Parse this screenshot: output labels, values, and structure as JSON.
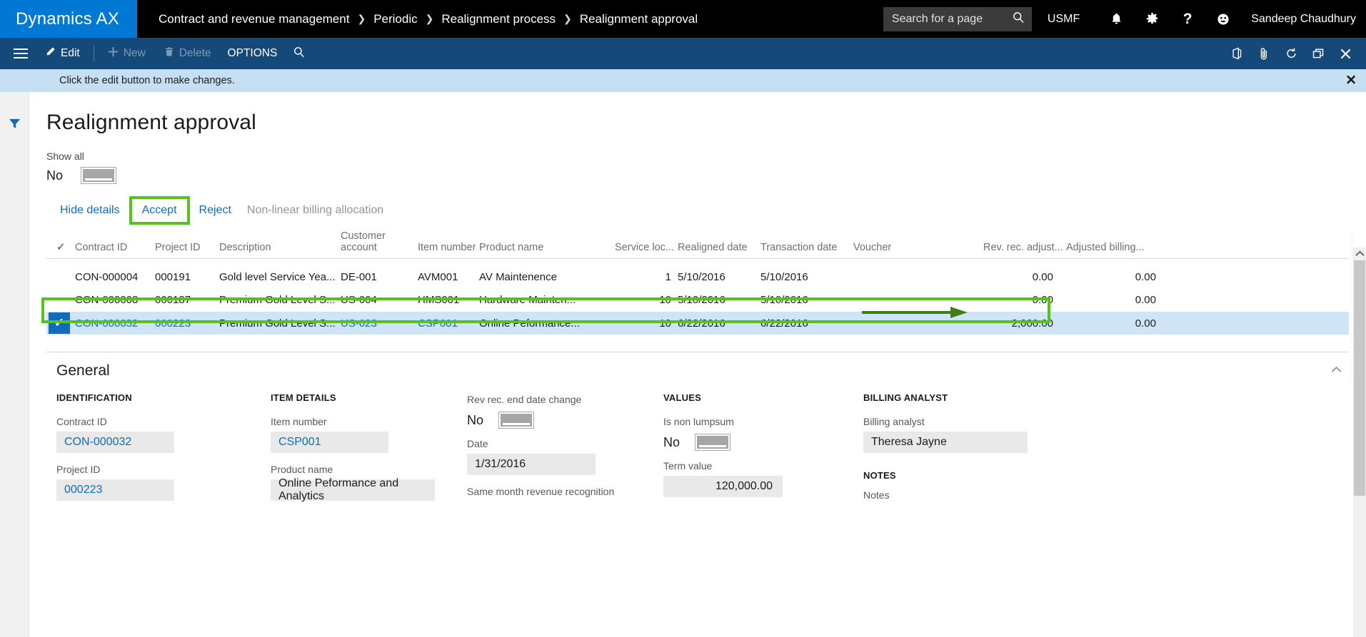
{
  "app": {
    "brand": "Dynamics AX",
    "breadcrumb": [
      "Contract and revenue management",
      "Periodic",
      "Realignment process",
      "Realignment approval"
    ],
    "search_placeholder": "Search for a page",
    "company": "USMF",
    "user": "Sandeep Chaudhury",
    "accent_blue": "#0078d4",
    "toolbar_blue": "#15497a",
    "highlight_green": "#52c41a",
    "link_blue": "#0f6cbd",
    "selected_row_bg": "#cfe4f7"
  },
  "toolbar": {
    "edit": "Edit",
    "new": "New",
    "delete": "Delete",
    "options": "OPTIONS",
    "search_icon": "magnifier-icon",
    "right_icons": [
      "office-icon",
      "attachment-icon",
      "refresh-icon",
      "window-icon",
      "close-icon"
    ]
  },
  "message_bar": {
    "text": "Click the edit button to make changes.",
    "close": "✕"
  },
  "page": {
    "title": "Realignment approval",
    "show_all_label": "Show all",
    "show_all_value": "No"
  },
  "grid_actions": {
    "hide_details": "Hide details",
    "accept": "Accept",
    "reject": "Reject",
    "non_linear": "Non-linear billing allocation"
  },
  "grid": {
    "columns": [
      "✓",
      "Contract ID",
      "Project ID",
      "Description",
      "Customer account",
      "Item number",
      "Product name",
      "Service loc...",
      "Realigned date",
      "Transaction date",
      "Voucher",
      "Rev. rec. adjust...",
      "Adjusted billing..."
    ],
    "rows": [
      {
        "selected": false,
        "contract_id": "CON-000004",
        "project_id": "000191",
        "description": "Gold level Service Yea...",
        "customer_account": "DE-001",
        "item_number": "AVM001",
        "product_name": "AV Maintenence",
        "service_loc": "1",
        "realigned_date": "5/10/2016",
        "transaction_date": "5/10/2016",
        "voucher": "",
        "rev_rec_adjust": "0.00",
        "adjusted_billing": "0.00"
      },
      {
        "selected": false,
        "contract_id": "CON-000008",
        "project_id": "000187",
        "description": "Premium Gold Level S...",
        "customer_account": "US-004",
        "item_number": "HMS001",
        "product_name": "Hardware Mainten...",
        "service_loc": "10",
        "realigned_date": "5/10/2016",
        "transaction_date": "5/10/2016",
        "voucher": "",
        "rev_rec_adjust": "0.00",
        "adjusted_billing": "0.00"
      },
      {
        "selected": true,
        "contract_id": "CON-000032",
        "project_id": "000223",
        "description": "Premium Gold Level S...",
        "customer_account": "US-023",
        "item_number": "CSP001",
        "product_name": "Online Peformance...",
        "service_loc": "10",
        "realigned_date": "6/22/2016",
        "transaction_date": "6/22/2016",
        "voucher": "",
        "rev_rec_adjust": "2,000.00",
        "adjusted_billing": "0.00"
      }
    ]
  },
  "general": {
    "title": "General",
    "identification": {
      "heading": "IDENTIFICATION",
      "contract_id_label": "Contract ID",
      "contract_id_value": "CON-000032",
      "project_id_label": "Project ID",
      "project_id_value": "000223"
    },
    "item_details": {
      "heading": "ITEM DETAILS",
      "item_number_label": "Item number",
      "item_number_value": "CSP001",
      "product_name_label": "Product name",
      "product_name_value": "Online Peformance and Analytics"
    },
    "dates": {
      "rev_rec_end_date_change_label": "Rev rec. end date change",
      "rev_rec_end_date_change_value": "No",
      "date_label": "Date",
      "date_value": "1/31/2016",
      "same_month_label": "Same month revenue recognition"
    },
    "values": {
      "heading": "VALUES",
      "is_non_lumpsum_label": "Is non lumpsum",
      "is_non_lumpsum_value": "No",
      "term_value_label": "Term value",
      "term_value_value": "120,000.00"
    },
    "billing_analyst": {
      "heading": "BILLING ANALYST",
      "label": "Billing analyst",
      "value": "Theresa Jayne",
      "notes_heading": "NOTES",
      "notes_label": "Notes"
    }
  }
}
